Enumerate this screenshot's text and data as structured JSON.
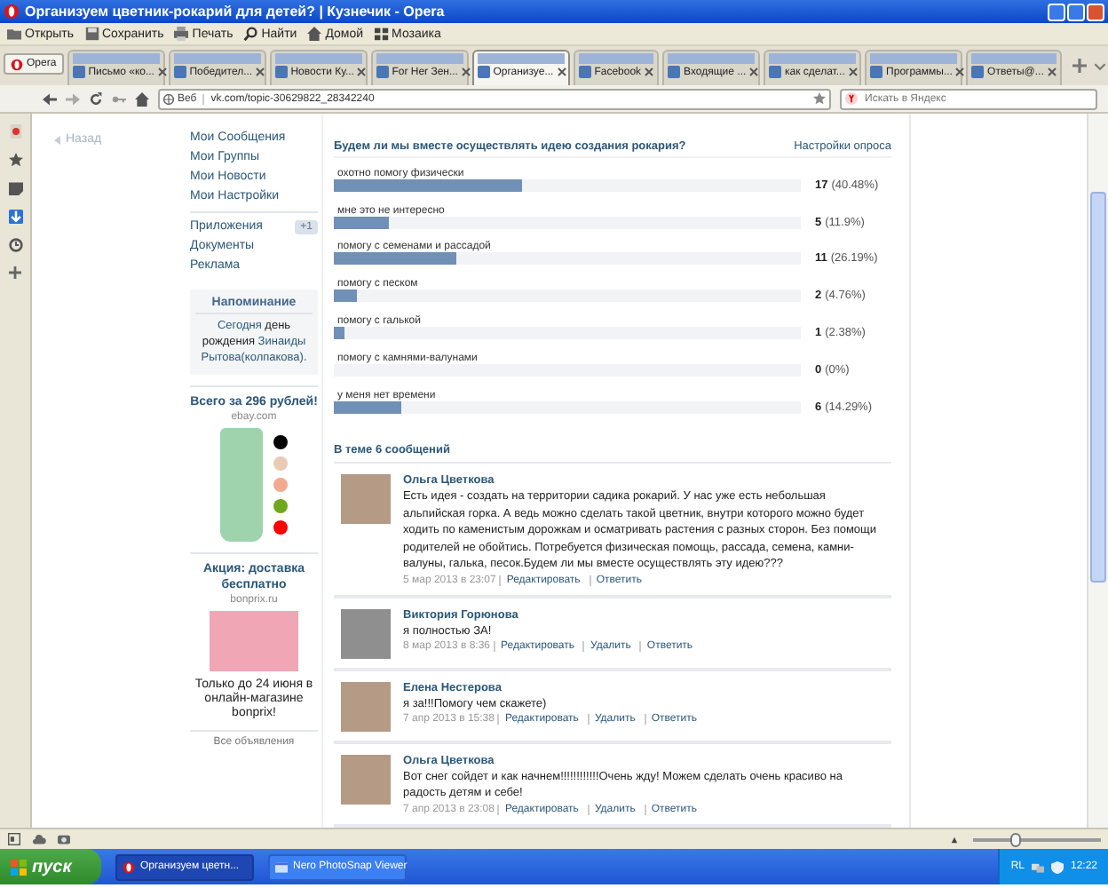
{
  "window": {
    "title": "Организуем цветник-рокарий для детей? | Кузнечик - Opera"
  },
  "toolbar": [
    {
      "kind": "folder",
      "label": "Открыть"
    },
    {
      "kind": "disk",
      "label": "Сохранить"
    },
    {
      "kind": "printer",
      "label": "Печать"
    },
    {
      "kind": "search",
      "label": "Найти"
    },
    {
      "kind": "home",
      "label": "Домой"
    },
    {
      "kind": "grid",
      "label": "Мозаика"
    }
  ],
  "opera_button": "Opera",
  "tabs": [
    {
      "label": "Письмо «ко...",
      "selected": false
    },
    {
      "label": "Победител...",
      "selected": false
    },
    {
      "label": "Новости Ку...",
      "selected": false
    },
    {
      "label": "For Her Зен...",
      "selected": false
    },
    {
      "label": "Организуе...",
      "selected": true
    },
    {
      "label": "Facebook",
      "selected": false
    },
    {
      "label": "Входящие ...",
      "selected": false
    },
    {
      "label": "как сделат...",
      "selected": false
    },
    {
      "label": "Программы...",
      "selected": false
    },
    {
      "label": "Ответы@...",
      "selected": false
    }
  ],
  "address_bar": {
    "badge": "Веб",
    "url": "vk.com/topic-30629822_28342240",
    "search_placeholder": "Искать в Яндекс"
  },
  "back_link": "Назад",
  "menu": [
    {
      "label": "Мои Сообщения"
    },
    {
      "label": "Мои Группы"
    },
    {
      "label": "Мои Новости"
    },
    {
      "label": "Мои Настройки"
    },
    {
      "label": "Приложения",
      "badge": "+1",
      "divider": true
    },
    {
      "label": "Документы"
    },
    {
      "label": "Реклама"
    }
  ],
  "reminder": {
    "title": "Напоминание",
    "parts": [
      {
        "text": "Сегодня",
        "link": true
      },
      {
        "text": "день рождения",
        "link": false
      },
      {
        "text": "Зинаиды",
        "link": true
      },
      {
        "text": "Рытова(колпакова).",
        "link": true
      }
    ]
  },
  "ads": [
    {
      "kind": "swatches",
      "title": "Всего за 296 рублей!",
      "domain": "ebay.com",
      "swatches": [
        {
          "color": "#000000"
        },
        {
          "color": "#e8cbb4"
        },
        {
          "color": "#f2a98e"
        },
        {
          "color": "#6fa81e"
        },
        {
          "color": "#ff0000"
        }
      ]
    },
    {
      "kind": "text",
      "title": "Акция: доставка бесплатно",
      "domain": "bonprix.ru",
      "text": "Только до 24 июня в онлайн-магазине bonprix!"
    }
  ],
  "all_ads": "Все объявления",
  "poll": {
    "question": "Будем ли мы вместе осуществлять идею создания рокария?",
    "settings": "Настройки опроса",
    "options": [
      {
        "label": "охотно помогу физически",
        "count": "17",
        "percent": "(40.48%)",
        "level": 0.4048
      },
      {
        "label": "мне это не интересно",
        "count": "5",
        "percent": "(11.9%)",
        "level": 0.119
      },
      {
        "label": "помогу с семенами и рассадой",
        "count": "11",
        "percent": "(26.19%)",
        "level": 0.2619
      },
      {
        "label": "помогу с песком",
        "count": "2",
        "percent": "(4.76%)",
        "level": 0.0476
      },
      {
        "label": "помогу с галькой",
        "count": "1",
        "percent": "(2.38%)",
        "level": 0.0238
      },
      {
        "label": "помогу с камнями-валунами",
        "count": "0",
        "percent": "(0%)",
        "level": 0
      },
      {
        "label": "у меня нет времени",
        "count": "6",
        "percent": "(14.29%)",
        "level": 0.1429
      }
    ]
  },
  "thread": {
    "count_label": "В теме 6 сообщений",
    "posts": [
      {
        "author": "Ольга Цветкова",
        "text": "Есть идея - создать на территории садика рокарий. У нас уже есть небольшая альпийская горка. А ведь можно сделать такой цветник, внутри которого можно будет ходить по каменистым дорожкам и осматривать растения с разных сторон. Без помощи родителей не обойтись. Потребуется физическая помощь, рассада, семена, камни-валуны, галька, песок.Будем ли мы вместе осуществлять эту идею???",
        "date": "5 мар 2013 в 23:07",
        "actions": [
          "Редактировать",
          "Ответить"
        ]
      },
      {
        "author": "Виктория Горюнова",
        "text": "я полностью ЗА!",
        "date": "8 мар 2013 в 8:36",
        "actions": [
          "Редактировать",
          "Удалить",
          "Ответить"
        ]
      },
      {
        "author": "Елена Нестерова",
        "text": "я за!!!Помогу чем скажете)",
        "date": "7 апр 2013 в 15:38",
        "actions": [
          "Редактировать",
          "Удалить",
          "Ответить"
        ]
      },
      {
        "author": "Ольга Цветкова",
        "text": "Вот снег сойдет и как начнем!!!!!!!!!!!!Очень жду! Можем сделать очень красиво на радость детям и себе!",
        "date": "7 апр 2013 в 23:08",
        "actions": [
          "Редактировать",
          "Удалить",
          "Ответить"
        ]
      }
    ]
  },
  "status_bar": {
    "zoom": {
      "level": 0.33
    }
  },
  "taskbar": {
    "start": "пуск",
    "tasks": [
      {
        "label": "Организуем цветн...",
        "selected": true
      },
      {
        "label": "Nero PhotoSnap Viewer",
        "selected": false
      }
    ],
    "tray_label": "RL",
    "clock": "12:22"
  }
}
